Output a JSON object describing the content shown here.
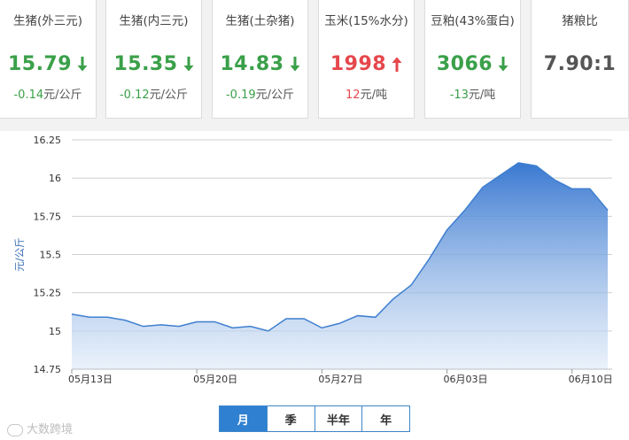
{
  "cards": [
    {
      "name": "生猪(外三元)",
      "price": "15.79",
      "direction": "down",
      "change": "-0.14",
      "unit": "元/公斤"
    },
    {
      "name": "生猪(内三元)",
      "price": "15.35",
      "direction": "down",
      "change": "-0.12",
      "unit": "元/公斤"
    },
    {
      "name": "生猪(土杂猪)",
      "price": "14.83",
      "direction": "down",
      "change": "-0.19",
      "unit": "元/公斤"
    },
    {
      "name": "玉米(15%水分)",
      "price": "1998",
      "direction": "up",
      "change": "12",
      "unit": "元/吨"
    },
    {
      "name": "豆粕(43%蛋白)",
      "price": "3066",
      "direction": "down",
      "change": "-13",
      "unit": "元/吨"
    },
    {
      "name": "猪粮比",
      "price": "7.90:1",
      "direction": "none",
      "change": "",
      "unit": ""
    }
  ],
  "colors": {
    "down": "#3aa049",
    "up": "#e5484d",
    "line": "#3f7fd0",
    "accent": "#2f80d1"
  },
  "tabs": [
    {
      "label": "月",
      "active": true
    },
    {
      "label": "季",
      "active": false
    },
    {
      "label": "半年",
      "active": false
    },
    {
      "label": "年",
      "active": false
    }
  ],
  "watermark": "大数跨境",
  "chart_data": {
    "type": "area",
    "ylabel": "元/公斤",
    "ylim": [
      14.75,
      16.25
    ],
    "yticks": [
      14.75,
      15,
      15.25,
      15.5,
      15.75,
      16,
      16.25
    ],
    "yticklabels": [
      "14.75",
      "15",
      "15.25",
      "15.5",
      "15.75",
      "16",
      "16.25"
    ],
    "xtick_labels": [
      {
        "index": 0,
        "label": "05月13日"
      },
      {
        "index": 7,
        "label": "05月20日"
      },
      {
        "index": 14,
        "label": "05月27日"
      },
      {
        "index": 21,
        "label": "06月03日"
      },
      {
        "index": 28,
        "label": "06月10日"
      }
    ],
    "grid": true,
    "series": [
      {
        "values": [
          15.11,
          15.09,
          15.09,
          15.07,
          15.03,
          15.04,
          15.03,
          15.06,
          15.06,
          15.02,
          15.03,
          15.0,
          15.08,
          15.08,
          15.02,
          15.05,
          15.1,
          15.09,
          15.21,
          15.3,
          15.47,
          15.66,
          15.79,
          15.94,
          16.02,
          16.1,
          16.08,
          15.99,
          15.93,
          15.93,
          15.79
        ]
      }
    ]
  }
}
